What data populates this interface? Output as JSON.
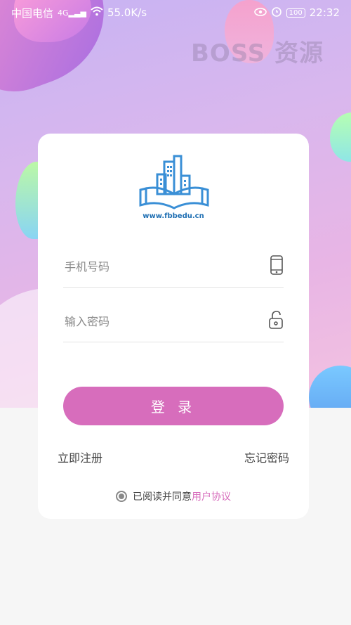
{
  "status_bar": {
    "carrier": "中国电信",
    "network": "4G",
    "speed": "55.0K/s",
    "battery": "100",
    "time": "22:32"
  },
  "watermark": "BOSS 资源",
  "logo": {
    "url_text": "www.fbbedu.cn"
  },
  "form": {
    "phone_placeholder": "手机号码",
    "password_placeholder": "输入密码",
    "login_label": "登 录",
    "register_label": "立即注册",
    "forgot_label": "忘记密码",
    "agree_text": "已阅读并同意",
    "protocol_text": "用户协议"
  },
  "colors": {
    "accent": "#d76dbc",
    "logo_blue": "#3a8fd6"
  },
  "icons": [
    "signal-icon",
    "wifi-icon",
    "eye-icon",
    "alarm-icon",
    "battery-icon",
    "phone-icon",
    "lock-icon",
    "radio-icon"
  ]
}
